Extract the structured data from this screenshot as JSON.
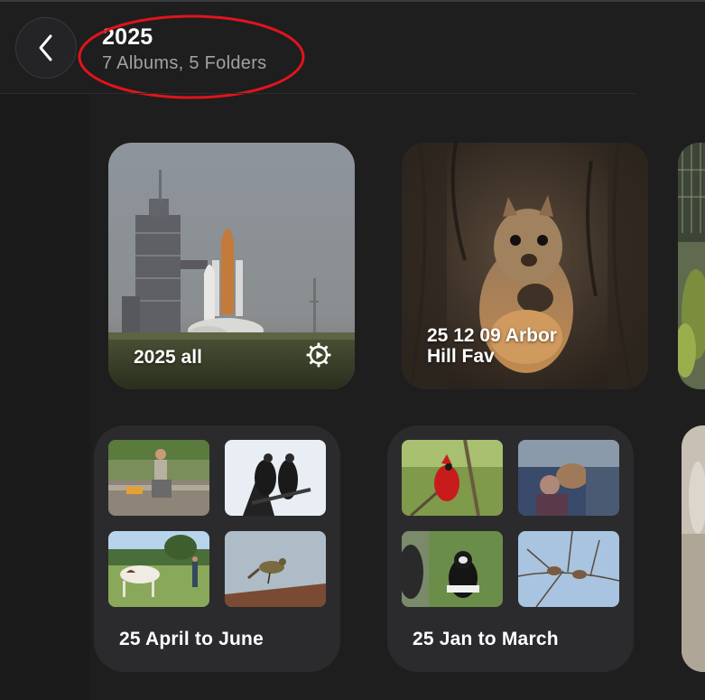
{
  "header": {
    "title": "2025",
    "subtitle": "7 Albums, 5 Folders"
  },
  "icons": {
    "back": "chevron-left-icon",
    "smart_album": "gear-play-icon"
  },
  "colors": {
    "background": "#1e1e1f",
    "folder_card": "#2b2b2d",
    "annotation": "#e0141b",
    "subtitle": "#a2a2a6"
  },
  "albums": [
    {
      "label": "2025 all",
      "image": "space shuttle on launch pad"
    },
    {
      "label": "25 12 09 Arbor\nHill Fav",
      "image": "squirrel in tree hollow"
    }
  ],
  "folders": [
    {
      "label": "25 April to June",
      "thumbnails": [
        "person sitting on ledge",
        "two vultures on branch",
        "horse in field",
        "bird on roof"
      ]
    },
    {
      "label": "25 Jan to March",
      "thumbnails": [
        "cardinal in tree",
        "squirrel at car window",
        "colobus monkey",
        "two birds on branches"
      ]
    }
  ]
}
